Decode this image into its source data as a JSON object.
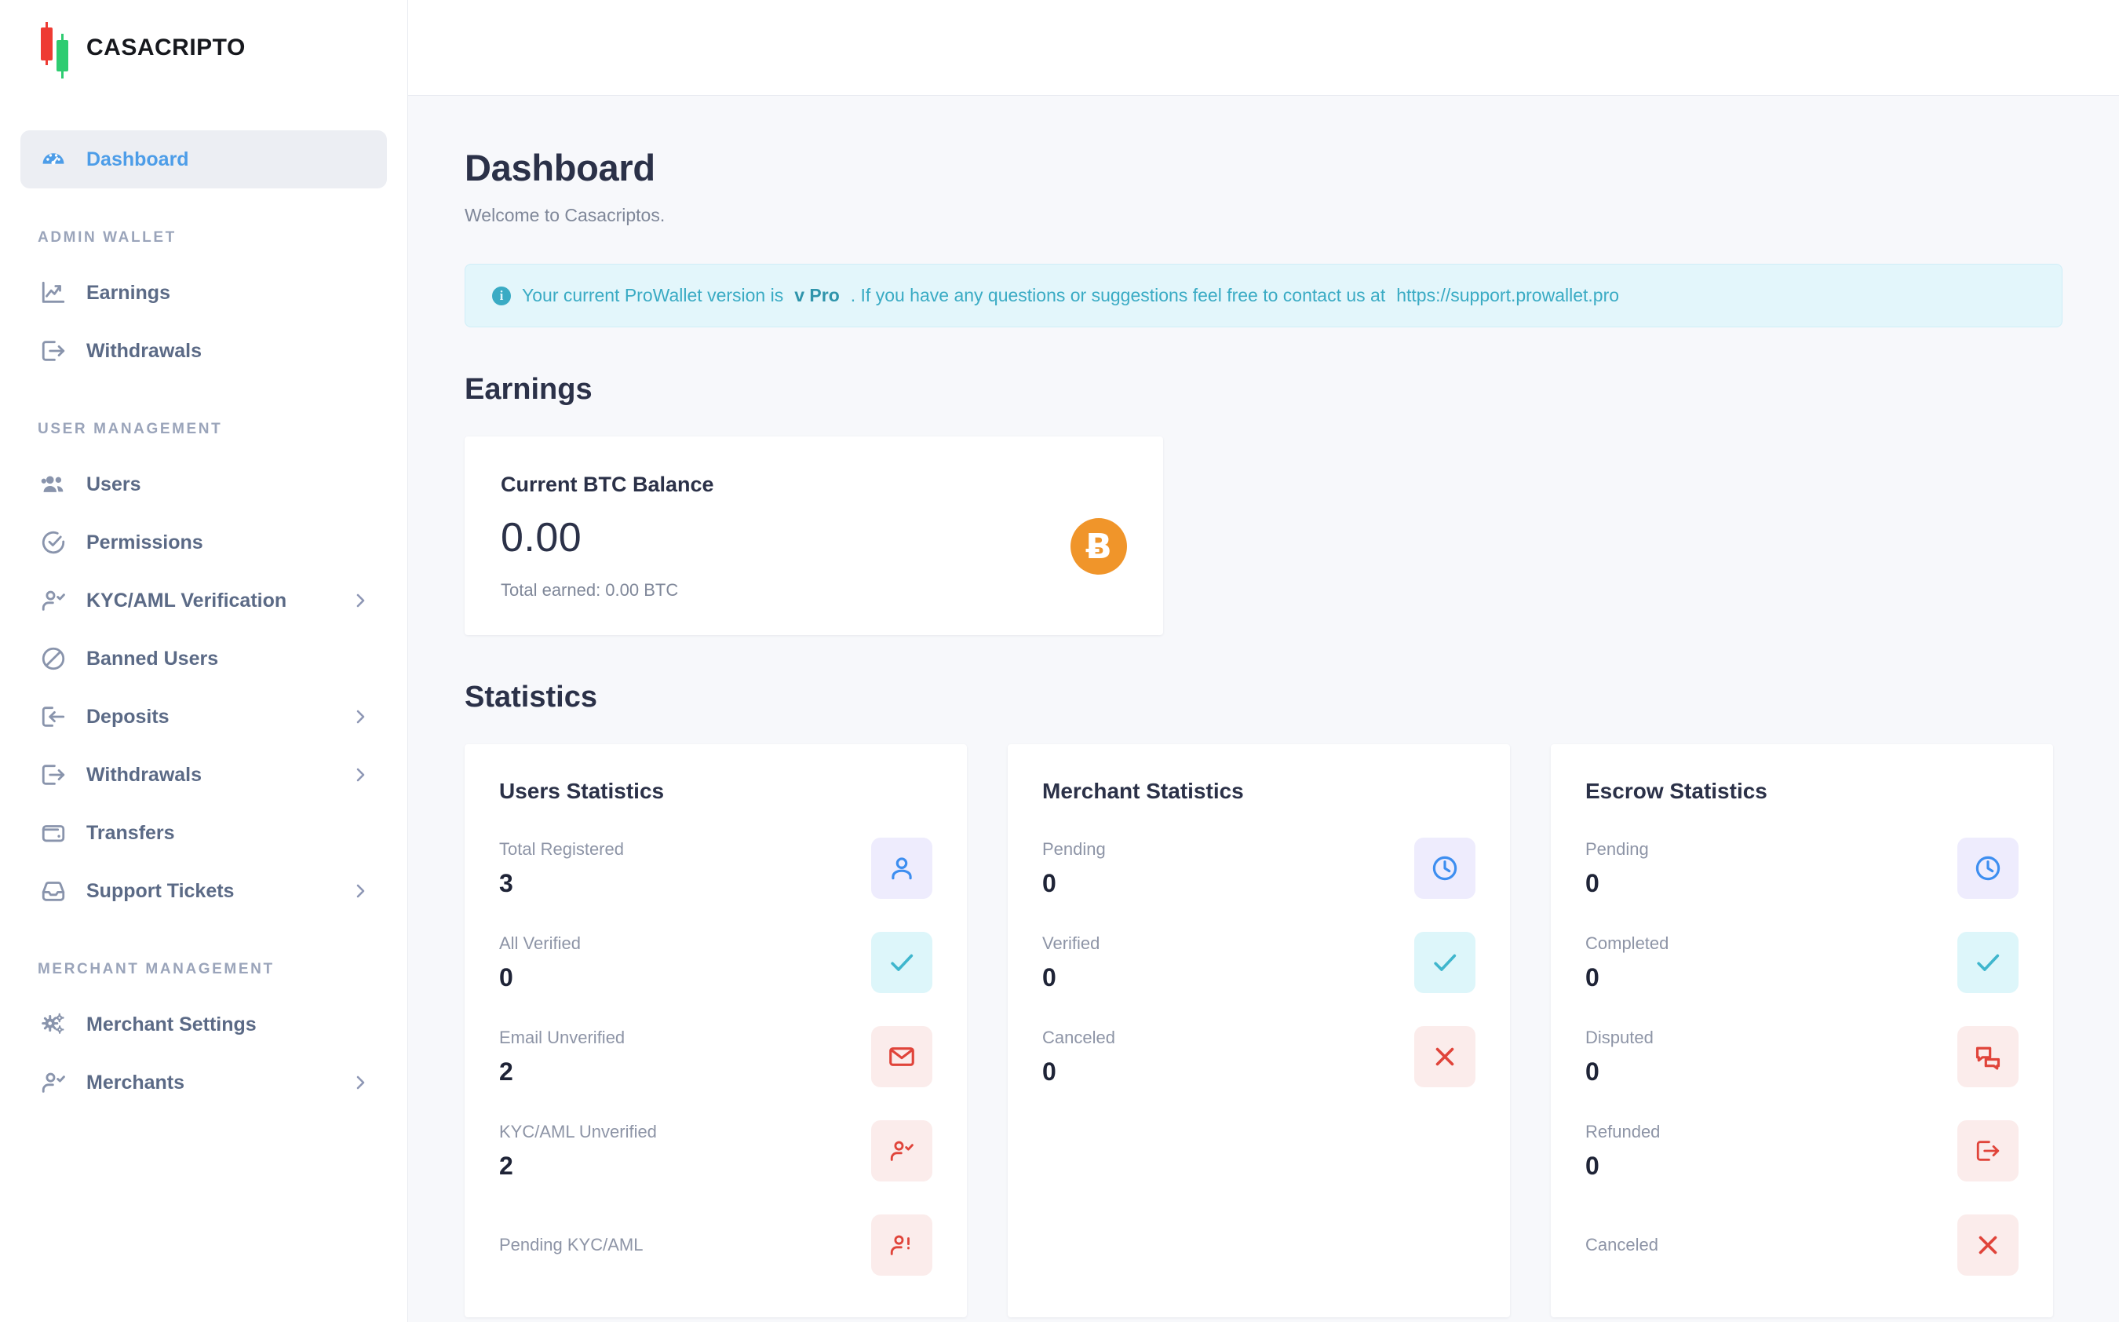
{
  "brand": {
    "name": "CASACRIPTO"
  },
  "sidebar": {
    "groups": [
      {
        "title": "",
        "items": [
          {
            "label": "Dashboard",
            "icon": "dashboard-icon",
            "active": true,
            "chevron": false
          }
        ]
      },
      {
        "title": "ADMIN WALLET",
        "items": [
          {
            "label": "Earnings",
            "icon": "chart-line-up-icon",
            "active": false,
            "chevron": false
          },
          {
            "label": "Withdrawals",
            "icon": "export-arrow-icon",
            "active": false,
            "chevron": false
          }
        ]
      },
      {
        "title": "USER MANAGEMENT",
        "items": [
          {
            "label": "Users",
            "icon": "users-group-icon",
            "active": false,
            "chevron": false
          },
          {
            "label": "Permissions",
            "icon": "check-circle-icon",
            "active": false,
            "chevron": false
          },
          {
            "label": "KYC/AML Verification",
            "icon": "user-check-icon",
            "active": false,
            "chevron": true
          },
          {
            "label": "Banned Users",
            "icon": "ban-icon",
            "active": false,
            "chevron": false
          },
          {
            "label": "Deposits",
            "icon": "import-arrow-icon",
            "active": false,
            "chevron": true
          },
          {
            "label": "Withdrawals",
            "icon": "export-arrow-icon",
            "active": false,
            "chevron": true
          },
          {
            "label": "Transfers",
            "icon": "wallet-icon",
            "active": false,
            "chevron": false
          },
          {
            "label": "Support Tickets",
            "icon": "inbox-icon",
            "active": false,
            "chevron": true
          }
        ]
      },
      {
        "title": "MERCHANT MANAGEMENT",
        "items": [
          {
            "label": "Merchant Settings",
            "icon": "gears-icon",
            "active": false,
            "chevron": false
          },
          {
            "label": "Merchants",
            "icon": "user-check-icon",
            "active": false,
            "chevron": true
          }
        ]
      }
    ]
  },
  "page": {
    "title": "Dashboard",
    "subtitle": "Welcome to Casacriptos."
  },
  "alert": {
    "icon": "info-icon",
    "text_before": "Your current ProWallet version is ",
    "version": "v Pro",
    "text_after": ". If you have any questions or suggestions feel free to contact us at ",
    "link": "https://support.prowallet.pro"
  },
  "earnings": {
    "section_title": "Earnings",
    "card": {
      "label": "Current BTC Balance",
      "value": "0.00",
      "total": "Total earned: 0.00 BTC",
      "badge_symbol": "Ƀ",
      "badge_color": "#f0952a"
    }
  },
  "statistics": {
    "section_title": "Statistics",
    "cards": [
      {
        "title": "Users Statistics",
        "rows": [
          {
            "name": "Total Registered",
            "value": "3",
            "icon": "person-icon",
            "tone": "violet"
          },
          {
            "name": "All Verified",
            "value": "0",
            "icon": "check-icon",
            "tone": "cyan"
          },
          {
            "name": "Email Unverified",
            "value": "2",
            "icon": "envelope-icon",
            "tone": "red"
          },
          {
            "name": "KYC/AML Unverified",
            "value": "2",
            "icon": "user-check-icon",
            "tone": "red"
          },
          {
            "name": "Pending KYC/AML",
            "value": "",
            "icon": "user-alert-icon",
            "tone": "red"
          }
        ]
      },
      {
        "title": "Merchant Statistics",
        "rows": [
          {
            "name": "Pending",
            "value": "0",
            "icon": "clock-icon",
            "tone": "violet"
          },
          {
            "name": "Verified",
            "value": "0",
            "icon": "check-icon",
            "tone": "cyan"
          },
          {
            "name": "Canceled",
            "value": "0",
            "icon": "x-icon",
            "tone": "red"
          }
        ]
      },
      {
        "title": "Escrow Statistics",
        "rows": [
          {
            "name": "Pending",
            "value": "0",
            "icon": "clock-icon",
            "tone": "violet"
          },
          {
            "name": "Completed",
            "value": "0",
            "icon": "check-icon",
            "tone": "cyan"
          },
          {
            "name": "Disputed",
            "value": "0",
            "icon": "chat-bubbles-icon",
            "tone": "red"
          },
          {
            "name": "Refunded",
            "value": "0",
            "icon": "export-arrow-icon",
            "tone": "red"
          },
          {
            "name": "Canceled",
            "value": "",
            "icon": "x-icon",
            "tone": "red"
          }
        ]
      }
    ]
  },
  "colors": {
    "accent": "#4d9de8",
    "sidebar_text": "#5b6a86",
    "heading": "#2b3148",
    "muted": "#8d94a6",
    "alert_bg": "#e3f6fb",
    "alert_text": "#3aabc4",
    "bitcoin": "#f0952a",
    "candle_red": "#ee3b33",
    "candle_green": "#2ecc71"
  }
}
